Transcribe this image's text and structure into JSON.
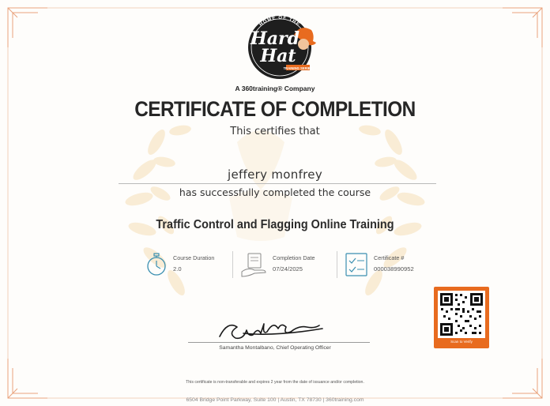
{
  "logo": {
    "top_arc_text": "HOME OF THE",
    "main_text_line1": "Hard",
    "main_text_line2": "Hat",
    "bottom_arc_text": "TRAINING SERIES",
    "icon": "hard-hat-worker-logo"
  },
  "company_tagline": "A 360training® Company",
  "title": "CERTIFICATE OF COMPLETION",
  "certifies_text": "This certifies that",
  "recipient_name": "jeffery  monfrey",
  "completed_text": "has successfully completed the course",
  "course_title": "Traffic Control and Flagging Online Training",
  "details": {
    "duration": {
      "label": "Course Duration",
      "value": "2.0",
      "icon": "stopwatch-icon"
    },
    "completion_date": {
      "label": "Completion Date",
      "value": "07/24/2025",
      "icon": "hand-certificate-icon"
    },
    "certificate_number": {
      "label": "Certificate #",
      "value": "000038990952",
      "icon": "checklist-icon"
    }
  },
  "qr": {
    "caption": "Scan to Verify",
    "icon": "qr-code"
  },
  "signature": {
    "signer": "Samantha Montalbano, Chief Operating Officer",
    "icon": "handwritten-signature"
  },
  "disclaimer": "This certificate is non-transferable and expires 2 year from the date of issuance and/or completion.",
  "address": "6504 Bridge Point Parkway, Suite 100  |  Austin, TX 78730  |  360training.com",
  "colors": {
    "accent": "#e86b1f",
    "border": "#e8a07a",
    "watermark": "#f6e3c4",
    "text": "#262626"
  }
}
